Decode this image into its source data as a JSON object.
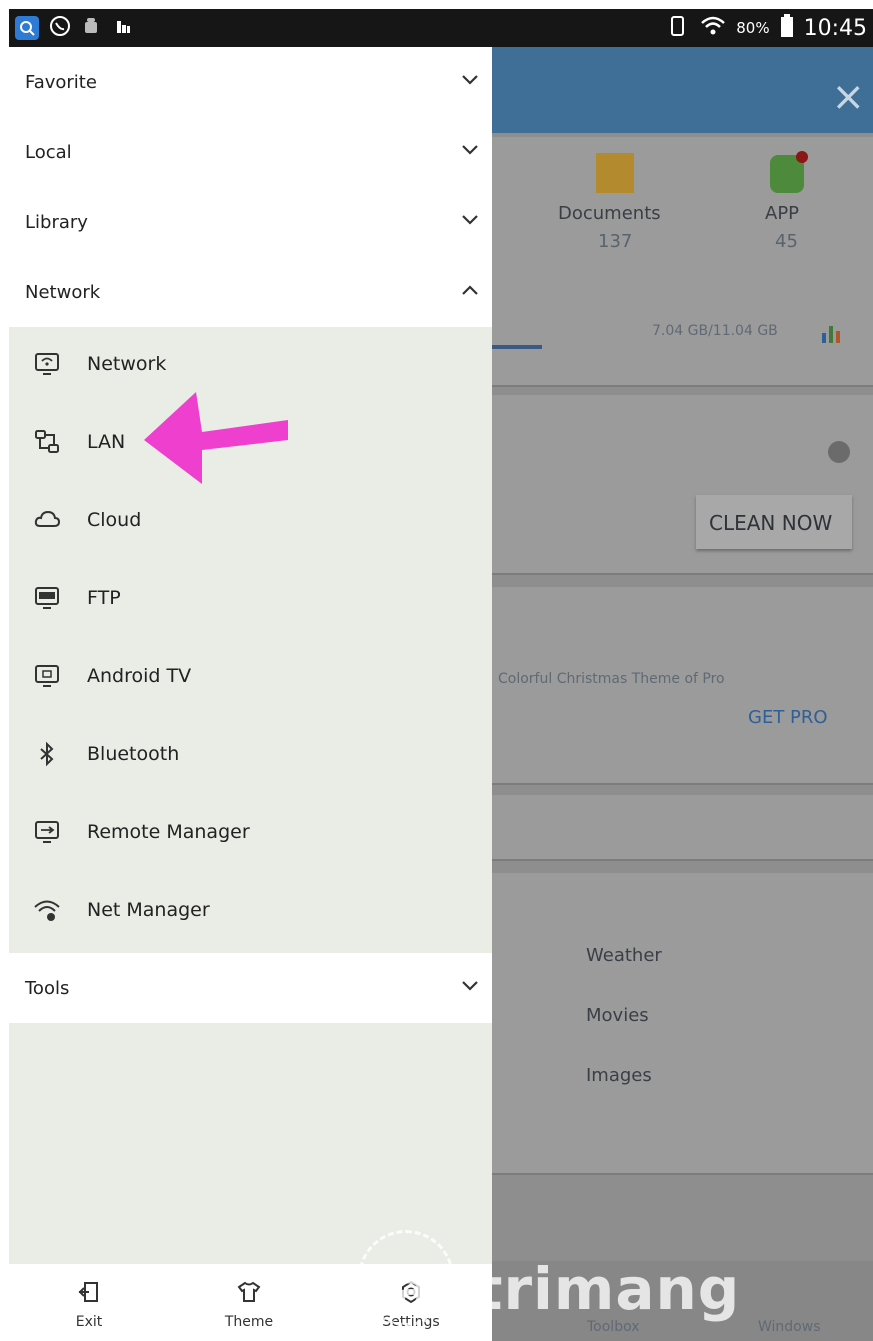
{
  "status_bar": {
    "battery": "80%",
    "time": "10:45"
  },
  "drawer": {
    "sections": {
      "favorite": "Favorite",
      "local": "Local",
      "library": "Library",
      "network": "Network",
      "tools": "Tools"
    },
    "network_items": [
      {
        "label": "Network",
        "icon": "monitor-wifi-icon"
      },
      {
        "label": "LAN",
        "icon": "lan-icon"
      },
      {
        "label": "Cloud",
        "icon": "cloud-icon"
      },
      {
        "label": "FTP",
        "icon": "ftp-icon"
      },
      {
        "label": "Android TV",
        "icon": "tv-icon"
      },
      {
        "label": "Bluetooth",
        "icon": "bluetooth-icon"
      },
      {
        "label": "Remote Manager",
        "icon": "remote-manager-icon"
      },
      {
        "label": "Net Manager",
        "icon": "wifi-gear-icon"
      }
    ],
    "bottom": {
      "exit": "Exit",
      "theme": "Theme",
      "settings": "Settings"
    }
  },
  "background": {
    "documents_label": "Documents",
    "documents_count": "137",
    "app_label": "APP",
    "app_count": "45",
    "storage_text": "7.04 GB/11.04 GB",
    "clean_button": "CLEAN NOW",
    "promo_text": "Colorful Christmas Theme of Pro",
    "get_pro": "GET PRO",
    "tools": [
      "Weather",
      "Movies",
      "Images"
    ],
    "bottom_toolbox": "Toolbox",
    "bottom_windows": "Windows"
  },
  "watermark": "uantrimang",
  "colors": {
    "accent_blue": "#3f6f96",
    "arrow_pink": "#ee3fcf",
    "drawer_bg": "#e9ede6"
  }
}
